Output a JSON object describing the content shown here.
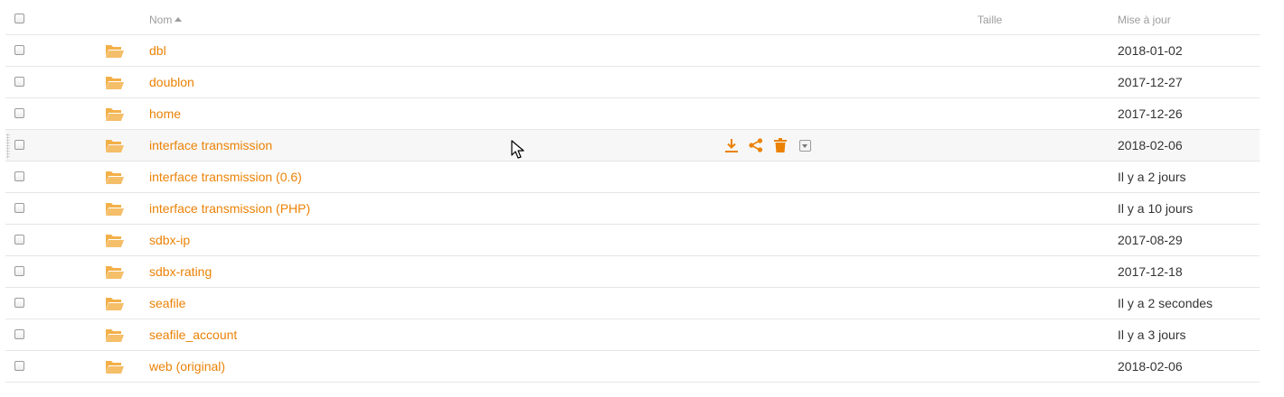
{
  "colors": {
    "accent": "#eb8205",
    "folder": "#f3b049",
    "text": "#333333",
    "header_text": "#9c9c9c",
    "divider": "#e6e6e6",
    "hover_row": "#f7f7f7"
  },
  "header": {
    "name_label": "Nom",
    "size_label": "Taille",
    "date_label": "Mise à jour",
    "sort": "ascending"
  },
  "rows": [
    {
      "name": "dbl",
      "size": "",
      "updated": "2018-01-02",
      "icon": "folder-open-icon"
    },
    {
      "name": "doublon",
      "size": "",
      "updated": "2017-12-27",
      "icon": "folder-open-icon"
    },
    {
      "name": "home",
      "size": "",
      "updated": "2017-12-26",
      "icon": "folder-open-icon"
    },
    {
      "name": "interface transmission",
      "size": "",
      "updated": "2018-02-06",
      "icon": "folder-open-icon",
      "hovered": true
    },
    {
      "name": "interface transmission (0.6)",
      "size": "",
      "updated": "Il y a 2 jours",
      "icon": "folder-open-icon"
    },
    {
      "name": "interface transmission (PHP)",
      "size": "",
      "updated": "Il y a 10 jours",
      "icon": "folder-open-icon"
    },
    {
      "name": "sdbx-ip",
      "size": "",
      "updated": "2017-08-29",
      "icon": "folder-open-icon"
    },
    {
      "name": "sdbx-rating",
      "size": "",
      "updated": "2017-12-18",
      "icon": "folder-open-icon"
    },
    {
      "name": "seafile",
      "size": "",
      "updated": "Il y a 2 secondes",
      "icon": "folder-open-icon"
    },
    {
      "name": "seafile_account",
      "size": "",
      "updated": "Il y a 3 jours",
      "icon": "folder-open-icon"
    },
    {
      "name": "web (original)",
      "size": "",
      "updated": "2018-02-06",
      "icon": "folder-open-icon"
    }
  ],
  "row_actions": [
    "download-icon",
    "share-icon",
    "trash-icon",
    "more-dropdown-icon"
  ]
}
